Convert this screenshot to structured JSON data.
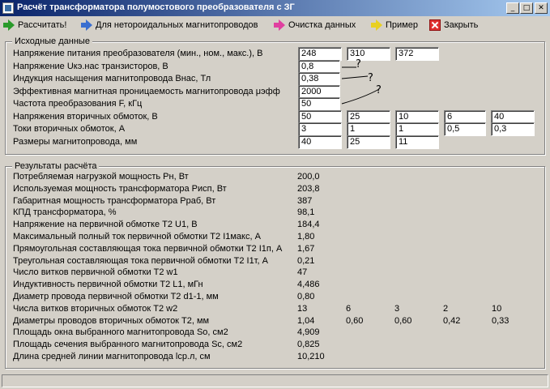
{
  "window": {
    "title": "Расчёт трансформатора полумостового преобразователя с ЗГ",
    "minimize_glyph": "_",
    "maximize_glyph": "□",
    "close_glyph": "✕"
  },
  "toolbar": {
    "calculate": "Рассчитать!",
    "non_toroidal": "Для нетороидальных магнитопроводов",
    "clear": "Очистка данных",
    "example": "Пример",
    "close": "Закрыть"
  },
  "inputs": {
    "legend": "Исходные данные",
    "rows": [
      {
        "label": "Напряжение питания преобразователя (мин., ном., макс.), В",
        "values": [
          "248",
          "310",
          "372"
        ]
      },
      {
        "label": "Напряжение Uкэ.нас транзисторов, В",
        "values": [
          "0,8"
        ]
      },
      {
        "label": "Индукция насыщения магнитопровода Внас, Тл",
        "values": [
          "0,38"
        ]
      },
      {
        "label": "Эффективная магнитная проницаемость магнитопровода μэфф",
        "values": [
          "2000"
        ]
      },
      {
        "label": "Частота преобразования F, кГц",
        "values": [
          "50"
        ]
      },
      {
        "label": "Напряжения вторичных обмоток, В",
        "values": [
          "50",
          "25",
          "10",
          "6",
          "40"
        ]
      },
      {
        "label": "Токи вторичных обмоток, А",
        "values": [
          "3",
          "1",
          "1",
          "0,5",
          "0,3"
        ]
      },
      {
        "label": "Размеры магнитопровода, мм",
        "values": [
          "40",
          "25",
          "11"
        ]
      }
    ],
    "annotation_marks": [
      "?",
      "?",
      "?"
    ]
  },
  "results": {
    "legend": "Результаты расчёта",
    "rows": [
      {
        "label": "Потребляемая нагрузкой мощность Рн, Вт",
        "values": [
          "200,0"
        ]
      },
      {
        "label": "Используемая мощность трансформатора Рисп, Вт",
        "values": [
          "203,8"
        ]
      },
      {
        "label": "Габаритная мощность трансформатора Рраб, Вт",
        "values": [
          "387"
        ]
      },
      {
        "label": "КПД трансформатора, %",
        "values": [
          "98,1"
        ]
      },
      {
        "label": "Напряжение на первичной обмотке Т2 U1, В",
        "values": [
          "184,4"
        ]
      },
      {
        "label": "Максимальный полный ток первичной обмотки Т2 I1макс, А",
        "values": [
          "1,80"
        ]
      },
      {
        "label": "Прямоугольная составляющая тока первичной обмотки Т2 I1п, А",
        "values": [
          "1,67"
        ]
      },
      {
        "label": "Треугольная составляющая тока первичной обмотки Т2 I1т, А",
        "values": [
          "0,21"
        ]
      },
      {
        "label": "Число витков первичной обмотки Т2 w1",
        "values": [
          "47"
        ]
      },
      {
        "label": "Индуктивность первичной обмотки Т2 L1, мГн",
        "values": [
          "4,486"
        ]
      },
      {
        "label": "Диаметр провода первичной обмотки Т2 d1-1, мм",
        "values": [
          "0,80"
        ]
      },
      {
        "label": "Числа витков вторичных обмоток Т2 w2",
        "values": [
          "13",
          "6",
          "3",
          "2",
          "10"
        ]
      },
      {
        "label": "Диаметры проводов вторичных обмоток Т2, мм",
        "values": [
          "1,04",
          "0,60",
          "0,60",
          "0,42",
          "0,33"
        ]
      },
      {
        "label": "Площадь окна выбранного магнитопровода So, см2",
        "values": [
          "4,909"
        ]
      },
      {
        "label": "Площадь сечения выбранного магнитопровода Sc, см2",
        "values": [
          "0,825"
        ]
      },
      {
        "label": "Длина средней линии магнитопровода lср.л, см",
        "values": [
          "10,210"
        ]
      }
    ]
  },
  "colors": {
    "titlebar_start": "#0a246a",
    "titlebar_end": "#a6caf0",
    "face": "#d4d0c8"
  }
}
